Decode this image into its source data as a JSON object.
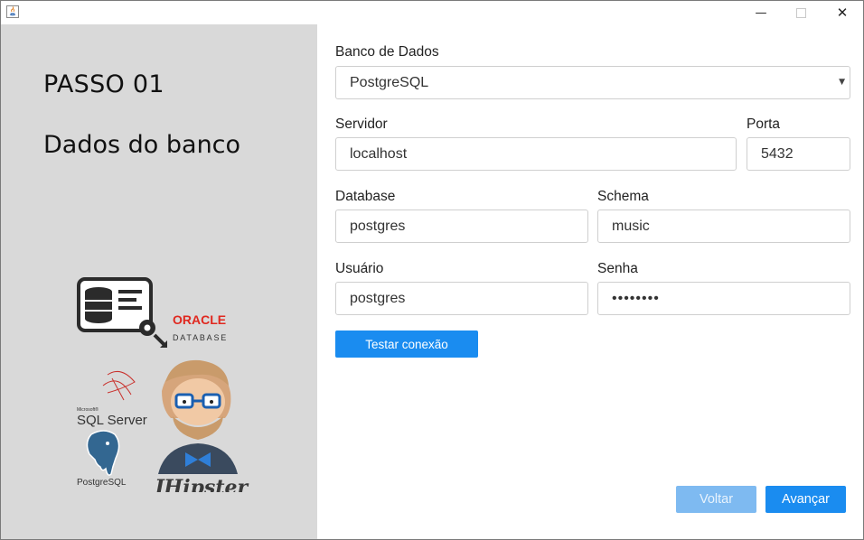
{
  "window": {
    "minimize_glyph": "—",
    "close_glyph": "✕"
  },
  "left": {
    "step": "PASSO 01",
    "subtitle": "Dados do banco",
    "logos": {
      "oracle_top": "ORACLE",
      "oracle_bottom": "DATABASE",
      "sqlserver_small": "Microsoft®",
      "sqlserver": "SQL Server",
      "postgresql": "PostgreSQL",
      "jhipster": "JHipster"
    }
  },
  "form": {
    "db_label": "Banco de Dados",
    "db_value": "PostgreSQL",
    "caret": "▼",
    "server_label": "Servidor",
    "server_value": "localhost",
    "port_label": "Porta",
    "port_value": "5432",
    "database_label": "Database",
    "database_value": "postgres",
    "schema_label": "Schema",
    "schema_value": "music",
    "user_label": "Usuário",
    "user_value": "postgres",
    "password_label": "Senha",
    "password_value": "••••••••",
    "test_button": "Testar conexão"
  },
  "footer": {
    "back_button": "Voltar",
    "next_button": "Avançar"
  },
  "colors": {
    "primary": "#1a8cf0",
    "primary_disabled": "#7ebaf1",
    "left_panel": "#d9d9d9"
  }
}
